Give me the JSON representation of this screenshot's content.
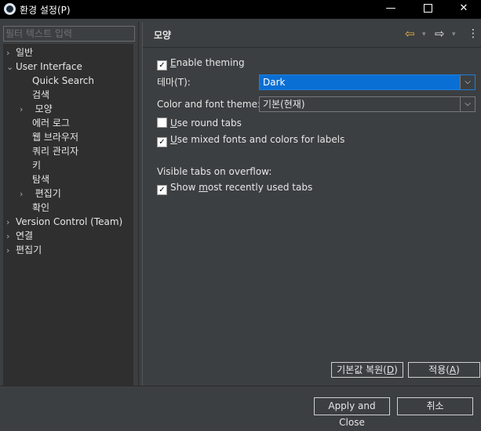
{
  "window": {
    "title": "환경 설정(P)",
    "minimize": "—",
    "close": "✕"
  },
  "filter": {
    "placeholder": "필터 텍스트 입력"
  },
  "tree": {
    "items": [
      {
        "label": "일반",
        "twisty": "›"
      },
      {
        "label": "User Interface",
        "twisty": "⌄"
      },
      {
        "label": "Quick Search"
      },
      {
        "label": "검색"
      },
      {
        "label": "모양",
        "twisty": "›"
      },
      {
        "label": "에러 로그"
      },
      {
        "label": "웹 브라우저"
      },
      {
        "label": "쿼리 관리자"
      },
      {
        "label": "키"
      },
      {
        "label": "탐색"
      },
      {
        "label": "편집기",
        "twisty": "›"
      },
      {
        "label": "확인"
      },
      {
        "label": "Version Control (Team)",
        "twisty": "›"
      },
      {
        "label": "연결",
        "twisty": "›"
      },
      {
        "label": "편집기",
        "twisty": "›"
      }
    ]
  },
  "page": {
    "title": "모양",
    "nav": {
      "back": "⇦",
      "forward": "⇨",
      "dropdown": "▾",
      "menu": "⋮"
    },
    "enable_theming": {
      "mnemonic": "E",
      "rest": "nable theming",
      "checked": true
    },
    "theme": {
      "label": "테마(T):",
      "value": "Dark",
      "arrow": "⌵"
    },
    "color_font_theme": {
      "label": "Color and font theme:",
      "value": "기본(현재)",
      "arrow": "⌵"
    },
    "round_tabs": {
      "mnemonic": "U",
      "rest": "se round tabs",
      "checked": false
    },
    "mixed_fonts": {
      "mnemonic": "U",
      "rest": "se mixed fonts and colors for labels",
      "checked": true
    },
    "visible_tabs_label": "Visible tabs on overflow:",
    "show_mru": {
      "pre": "Show ",
      "mnemonic": "m",
      "rest": "ost recently used tabs",
      "checked": true
    },
    "check_mark": "✓",
    "restore_defaults": {
      "pre": "기본값 복원(",
      "mnemonic": "D",
      "post": ")"
    },
    "apply": {
      "pre": "적용(",
      "mnemonic": "A",
      "post": ")"
    }
  },
  "footer": {
    "apply_close": "Apply and Close",
    "cancel": "취소"
  },
  "colors": {
    "background": "#3c3f41",
    "tree_background": "#2f2f2f",
    "selected_combo": "#0a6fd4",
    "back_arrow": "#e8b04a",
    "titlebar": "#000000"
  }
}
